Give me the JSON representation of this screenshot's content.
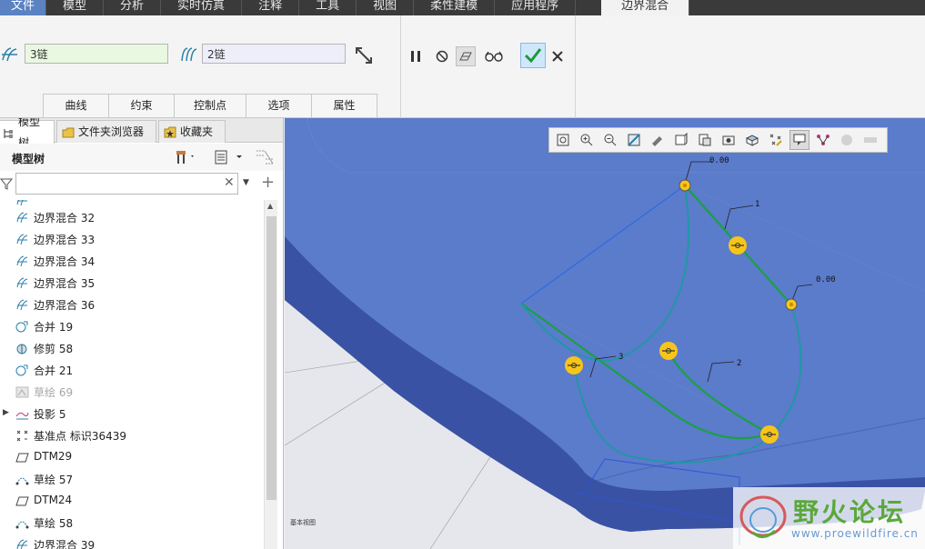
{
  "ribbon_tabs": [
    "文件",
    "模型",
    "分析",
    "实时仿真",
    "注释",
    "工具",
    "视图",
    "柔性建模",
    "应用程序",
    "边界混合"
  ],
  "chains": {
    "first": "3链",
    "second": "2链"
  },
  "sub_tabs": [
    "曲线",
    "约束",
    "控制点",
    "选项",
    "属性"
  ],
  "panel_tabs": {
    "model_tree": "模型树",
    "folder_browser": "文件夹浏览器",
    "favorites": "收藏夹"
  },
  "tree_title": "模型树",
  "tree_items": [
    {
      "label": "边界混合 32",
      "icon": "boundary-blend-icon",
      "state": "normal"
    },
    {
      "label": "边界混合 33",
      "icon": "boundary-blend-icon",
      "state": "normal"
    },
    {
      "label": "边界混合 34",
      "icon": "boundary-blend-icon",
      "state": "normal"
    },
    {
      "label": "边界混合 35",
      "icon": "boundary-blend-icon",
      "state": "normal"
    },
    {
      "label": "边界混合 36",
      "icon": "boundary-blend-icon",
      "state": "normal"
    },
    {
      "label": "合并 19",
      "icon": "merge-icon",
      "state": "normal"
    },
    {
      "label": "修剪 58",
      "icon": "trim-icon",
      "state": "normal"
    },
    {
      "label": "合并 21",
      "icon": "merge-icon",
      "state": "normal"
    },
    {
      "label": "草绘 69",
      "icon": "sketch-icon",
      "state": "grey"
    },
    {
      "label": "投影 5",
      "icon": "projection-icon",
      "state": "expandable"
    },
    {
      "label": "基准点 标识36439",
      "icon": "datum-point-icon",
      "state": "normal"
    },
    {
      "label": "DTM29",
      "icon": "datum-plane-icon",
      "state": "normal"
    },
    {
      "label": "草绘 57",
      "icon": "sketch-icon",
      "state": "normal"
    },
    {
      "label": "DTM24",
      "icon": "datum-plane-icon",
      "state": "normal"
    },
    {
      "label": "草绘 58",
      "icon": "sketch-icon",
      "state": "normal"
    },
    {
      "label": "边界混合 39",
      "icon": "boundary-blend-icon",
      "state": "normal"
    }
  ],
  "viewport": {
    "annotations": [
      "0.00",
      "1",
      "0.00",
      "2",
      "3"
    ],
    "small_label": "基本视图",
    "watermark_title": "野火论坛",
    "watermark_url": "www.proewildfire.cn"
  },
  "colors": {
    "model_surface": "#4f6fbd",
    "curve_green": "#1aa043",
    "curve_teal": "#1b9aa0",
    "control_point": "#f7c51a",
    "active_tab": "#5b82c2"
  }
}
